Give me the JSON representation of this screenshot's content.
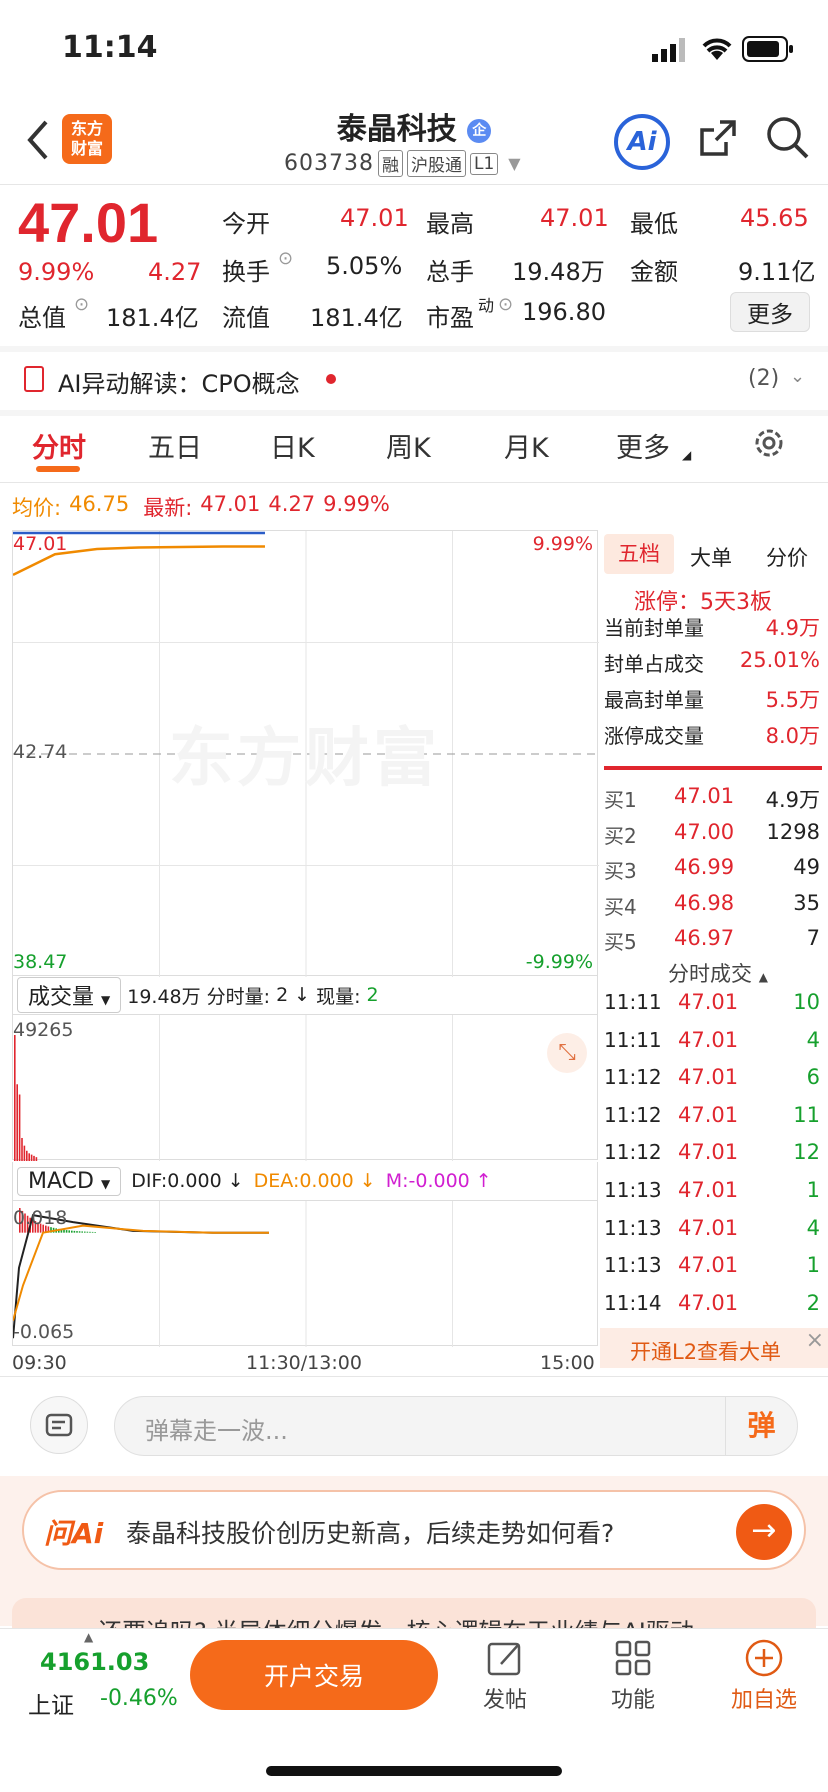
{
  "status_bar": {
    "time": "11:14"
  },
  "header": {
    "title": "泰晶科技",
    "badge": "企",
    "code": "603738",
    "tags": [
      "融",
      "沪股通",
      "L1"
    ],
    "logo_text": "东方\n财富",
    "ai_label": "Ai"
  },
  "quote": {
    "price": "47.01",
    "change_pct": "9.99%",
    "change": "4.27",
    "fields": {
      "open_label": "今开",
      "open": "47.01",
      "high_label": "最高",
      "high": "47.01",
      "low_label": "最低",
      "low": "45.65",
      "turnover_label": "换手",
      "turnover": "5.05%",
      "volume_label": "总手",
      "volume": "19.48万",
      "amount_label": "金额",
      "amount": "9.11亿",
      "mktcap_label": "总值",
      "mktcap": "181.4亿",
      "float_label": "流值",
      "float": "181.4亿",
      "pe_label": "市盈",
      "pe_sup": "动",
      "pe": "196.80"
    },
    "more": "更多"
  },
  "ai_banner": {
    "label": "AI异动解读：CPO概念",
    "count": "(2)"
  },
  "tabs": [
    "分时",
    "五日",
    "日K",
    "周K",
    "月K",
    "更多"
  ],
  "chart_header": {
    "avg_label": "均价:",
    "avg": "46.75",
    "latest_label": "最新:",
    "latest": "47.01",
    "change": "4.27",
    "pct": "9.99%"
  },
  "chart_data": [
    {
      "type": "line",
      "name": "intraday-price",
      "y_top_label": "47.01",
      "y_mid_label": "42.74",
      "y_bottom_label": "38.47",
      "pct_top_label": "9.99%",
      "pct_bottom_label": "-9.99%",
      "ylim": [
        38.47,
        47.01
      ],
      "series": [
        {
          "name": "price",
          "color": "#2a5cc7",
          "values": [
            47.01,
            47.01,
            47.01,
            47.01,
            47.01,
            47.01,
            47.01
          ]
        },
        {
          "name": "avg",
          "color": "#f08a00",
          "values": [
            46.2,
            46.6,
            46.7,
            46.73,
            46.74,
            46.75,
            46.75
          ]
        }
      ],
      "x_labels": [
        "09:30",
        "11:30/13:00",
        "15:00"
      ]
    },
    {
      "type": "bar",
      "name": "volume",
      "y_top_label": "49265",
      "values": [
        49265,
        30000,
        26000,
        9000,
        6000,
        4000,
        3000,
        2500,
        2000,
        1500
      ]
    },
    {
      "type": "line",
      "name": "macd",
      "y_top_label": "0.018",
      "y_bottom_label": "-0.065",
      "ylim": [
        -0.065,
        0.018
      ]
    }
  ],
  "volume_header": {
    "select": "成交量",
    "total": "19.48万",
    "label1": "分时量:",
    "v1": "2",
    "arrow1": "↓",
    "label2": "现量:",
    "v2": "2"
  },
  "macd_header": {
    "select": "MACD",
    "dif": "DIF:0.000 ↓",
    "dea": "DEA:0.000 ↓",
    "m": "M:-0.000 ↑"
  },
  "side": {
    "tabs": [
      "五档",
      "大单",
      "分价"
    ],
    "limit": "涨停：5天3板",
    "stats": [
      {
        "label": "当前封单量",
        "value": "4.9万"
      },
      {
        "label": "封单占成交",
        "value": "25.01%"
      },
      {
        "label": "最高封单量",
        "value": "5.5万"
      },
      {
        "label": "涨停成交量",
        "value": "8.0万"
      }
    ],
    "bids": [
      {
        "label": "买1",
        "price": "47.01",
        "vol": "4.9万"
      },
      {
        "label": "买2",
        "price": "47.00",
        "vol": "1298"
      },
      {
        "label": "买3",
        "price": "46.99",
        "vol": "49"
      },
      {
        "label": "买4",
        "price": "46.98",
        "vol": "35"
      },
      {
        "label": "买5",
        "price": "46.97",
        "vol": "7"
      }
    ],
    "trades_title": "分时成交",
    "trades": [
      {
        "t": "11:11",
        "p": "47.01",
        "v": "10"
      },
      {
        "t": "11:11",
        "p": "47.01",
        "v": "4"
      },
      {
        "t": "11:12",
        "p": "47.01",
        "v": "6"
      },
      {
        "t": "11:12",
        "p": "47.01",
        "v": "11"
      },
      {
        "t": "11:12",
        "p": "47.01",
        "v": "12"
      },
      {
        "t": "11:13",
        "p": "47.01",
        "v": "1"
      },
      {
        "t": "11:13",
        "p": "47.01",
        "v": "4"
      },
      {
        "t": "11:13",
        "p": "47.01",
        "v": "1"
      },
      {
        "t": "11:14",
        "p": "47.01",
        "v": "2"
      }
    ],
    "l2": "开通L2查看大单"
  },
  "danmu": {
    "placeholder": "弹幕走一波...",
    "btn": "弹"
  },
  "ask_ai": {
    "logo": "问Ai",
    "question": "泰晶科技股价创历史新高，后续走势如何看?"
  },
  "news_peek": "还要追吗? 半导体细分爆发，核心逻辑在于业绩与AI驱动",
  "bottom": {
    "index_value": "4161.03",
    "index_name": "上证",
    "index_change": "-0.46%",
    "trade_btn": "开户交易",
    "post": "发帖",
    "func": "功能",
    "watch": "加自选"
  }
}
